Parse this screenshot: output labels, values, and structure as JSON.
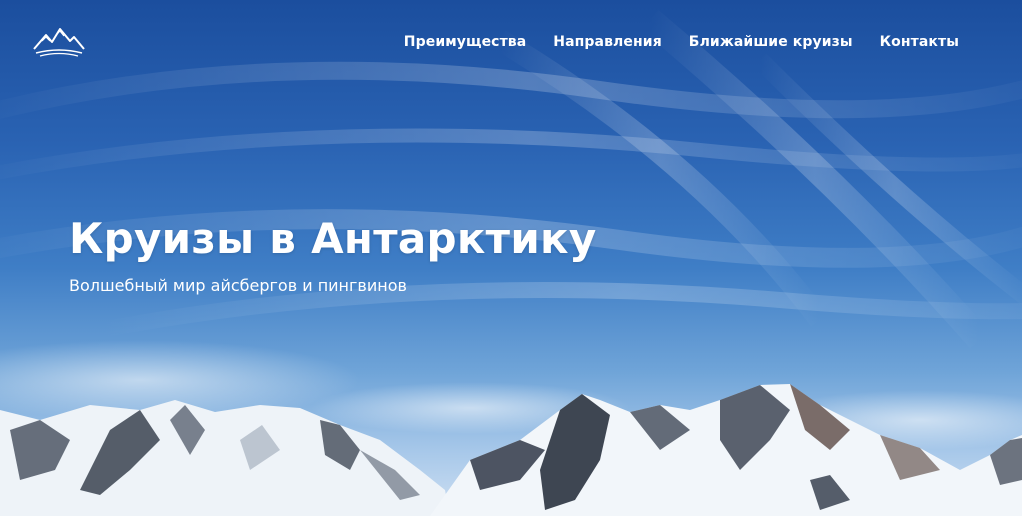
{
  "header": {
    "logo_icon": "mountain-logo-icon",
    "nav": [
      {
        "label": "Преимущества"
      },
      {
        "label": "Направления"
      },
      {
        "label": "Ближайшие круизы"
      },
      {
        "label": "Контакты"
      }
    ]
  },
  "hero": {
    "title": "Круизы в Антарктику",
    "subtitle": "Волшебный мир айсбергов и пингвинов",
    "background": "antarctic-mountains-sky-image"
  },
  "colors": {
    "sky_top": "#1b4e9e",
    "sky_bottom": "#cfe0f2",
    "text": "#ffffff"
  }
}
